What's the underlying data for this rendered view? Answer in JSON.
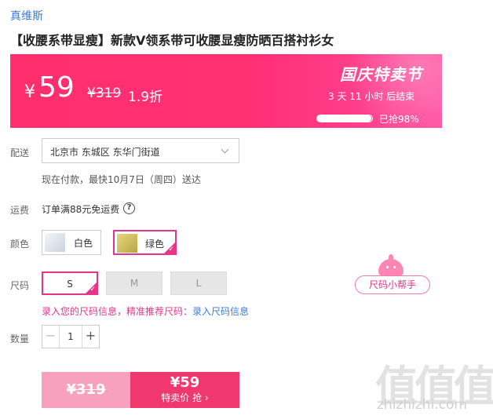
{
  "brand": "真维斯",
  "product_title": "【收腰系带显瘦】新款V领系带可收腰显瘦防晒百搭衬衫女",
  "banner": {
    "currency": "¥",
    "price": "59",
    "original_price": "¥319",
    "discount": "1.9折",
    "event_name": "国庆特卖节",
    "countdown": "3  天  11  小时  后结束",
    "sold_progress": 0.98,
    "sold_text": "已抢98%",
    "colors": {
      "primary": "#ff2f6e",
      "accent": "#ff53a3"
    }
  },
  "delivery": {
    "label": "配送",
    "address": "北京市 东城区 东华门街道",
    "estimate": "现在付款，最快10月7日（周四）送达"
  },
  "shipping": {
    "label": "运费",
    "text": "订单满88元免运费",
    "help_icon": "question-circle-icon",
    "help_symbol": "?"
  },
  "color": {
    "label": "颜色",
    "options": [
      {
        "name": "白色",
        "selected": false,
        "swatch": "#dfe6ec"
      },
      {
        "name": "绿色",
        "selected": true,
        "swatch": "#d9c86a"
      }
    ]
  },
  "size": {
    "label": "尺码",
    "options": [
      {
        "name": "S",
        "selected": true
      },
      {
        "name": "M",
        "selected": false
      },
      {
        "name": "L",
        "selected": false
      }
    ],
    "hint": "录入您的尺码信息，精准推荐尺码：",
    "hint_link": "录入尺码信息",
    "helper_button": "尺码小帮手"
  },
  "quantity": {
    "label": "数量",
    "value": "1",
    "minus": "−",
    "plus": "+"
  },
  "buy": {
    "original_price": "¥319",
    "special_price": "¥59",
    "special_label": "特卖价 抢 ›"
  },
  "watermark": {
    "mark": "值值值",
    "url": "zhizhizhi.com"
  },
  "check_mark": "✓"
}
